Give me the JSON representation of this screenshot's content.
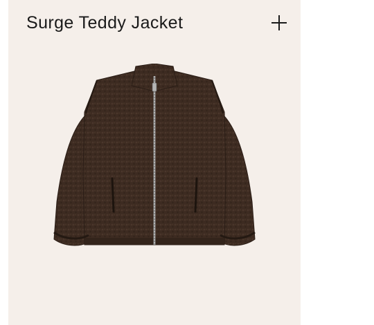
{
  "product": {
    "title": "Surge Teddy Jacket",
    "add_icon": "plus-icon",
    "image": {
      "subject": "dark-brown sherpa zip jacket",
      "color": "#3d2b21"
    }
  },
  "colors": {
    "card_background": "#f5efea",
    "text": "#1a1a1a"
  }
}
